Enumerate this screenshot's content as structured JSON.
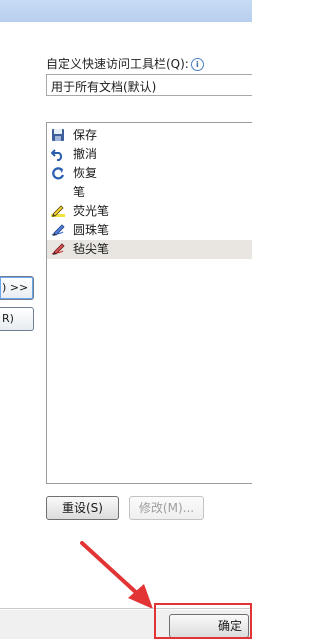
{
  "toolbar_section": {
    "label": "自定义快速访问工具栏(Q):",
    "info_icon": "info-icon",
    "selected_document": "用于所有文档(默认)"
  },
  "commands": [
    {
      "label": "保存",
      "icon": "save-icon"
    },
    {
      "label": "撤消",
      "icon": "undo-icon"
    },
    {
      "label": "恢复",
      "icon": "redo-icon"
    },
    {
      "label": "笔",
      "icon": "none"
    },
    {
      "label": "荧光笔",
      "icon": "highlighter-icon"
    },
    {
      "label": "圆珠笔",
      "icon": "ballpoint-pen-icon"
    },
    {
      "label": "毡尖笔",
      "icon": "felt-tip-pen-icon"
    }
  ],
  "selected_command": "毡尖笔",
  "side_buttons": {
    "add_label": ") >>",
    "remove_label": "R)"
  },
  "bottom_buttons": {
    "reset_label": "重设(S)",
    "modify_label": "修改(M)..."
  },
  "footer": {
    "ok_label": "确定"
  },
  "colors": {
    "annotation_red": "#e23434",
    "selection_bg": "#e9e6e2",
    "title_strip": "#c7dbf4"
  }
}
